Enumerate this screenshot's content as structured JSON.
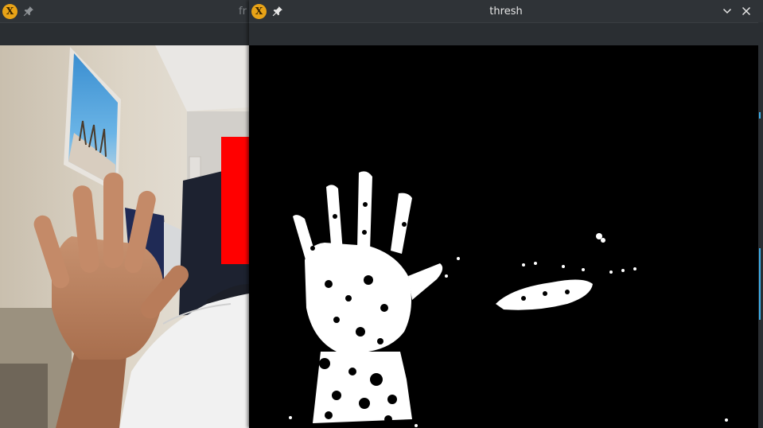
{
  "windows": {
    "frame": {
      "title": "frame",
      "title_visible": "fr",
      "icon": "xming-app-icon",
      "pin_icon": "pin-icon",
      "detector_box_color": "#ff0000"
    },
    "thresh": {
      "title": "thresh",
      "icon": "xming-app-icon",
      "pin_icon": "pin-icon",
      "controls": [
        "chevron-down-icon",
        "close-icon"
      ]
    }
  },
  "colors": {
    "titlebar": "#2f3337",
    "title_text": "#e6e6e6",
    "app_icon": "#e8a317",
    "detector_box": "#ff0000",
    "accent": "#3daee9"
  }
}
